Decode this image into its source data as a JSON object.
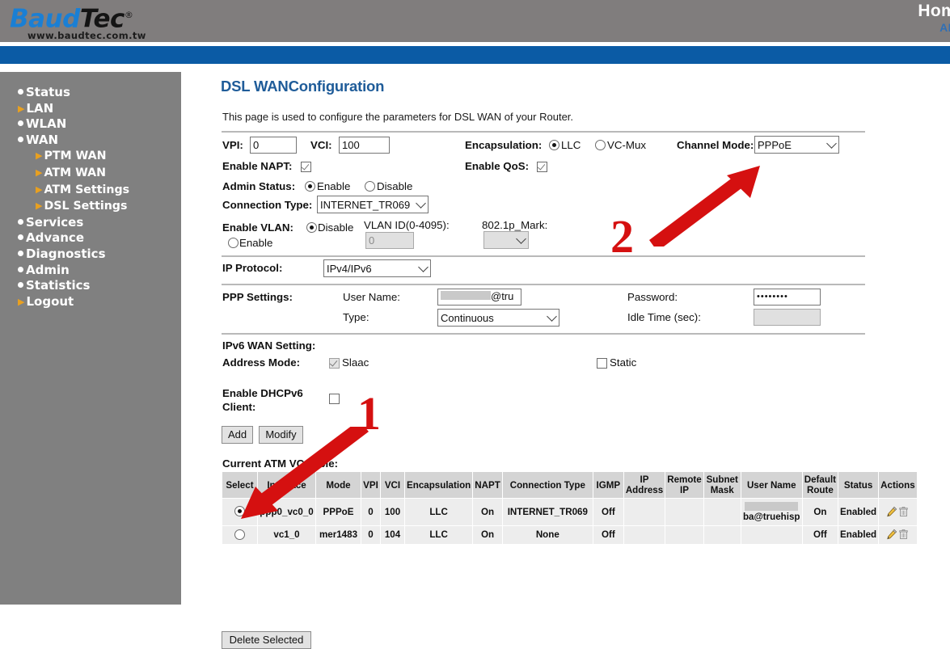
{
  "header": {
    "logo_brand_1": "Baud",
    "logo_brand_2": "Tec",
    "logo_reg": "®",
    "logo_url": "www.baudtec.com.tw",
    "home_label": "Hom",
    "adsl_label": "AD"
  },
  "sidebar": {
    "items": [
      {
        "label": "Status",
        "marker": "bullet",
        "sub": false
      },
      {
        "label": "LAN",
        "marker": "arrow",
        "sub": false
      },
      {
        "label": "WLAN",
        "marker": "bullet",
        "sub": false
      },
      {
        "label": "WAN",
        "marker": "bullet",
        "sub": false
      },
      {
        "label": "PTM WAN",
        "marker": "arrow",
        "sub": true
      },
      {
        "label": "ATM WAN",
        "marker": "arrow",
        "sub": true
      },
      {
        "label": "ATM Settings",
        "marker": "arrow",
        "sub": true
      },
      {
        "label": "DSL Settings",
        "marker": "arrow",
        "sub": true
      },
      {
        "label": "Services",
        "marker": "bullet",
        "sub": false
      },
      {
        "label": "Advance",
        "marker": "bullet",
        "sub": false
      },
      {
        "label": "Diagnostics",
        "marker": "bullet",
        "sub": false
      },
      {
        "label": "Admin",
        "marker": "bullet",
        "sub": false
      },
      {
        "label": "Statistics",
        "marker": "bullet",
        "sub": false
      },
      {
        "label": "Logout",
        "marker": "arrow",
        "sub": false
      }
    ]
  },
  "page": {
    "title": "DSL WANConfiguration",
    "description": "This page is used to configure the parameters for DSL WAN of your Router."
  },
  "form": {
    "vpi_label": "VPI:",
    "vpi_value": "0",
    "vci_label": "VCI:",
    "vci_value": "100",
    "encapsulation_label": "Encapsulation:",
    "encap_llc_label": "LLC",
    "encap_vcmux_label": "VC-Mux",
    "channel_mode_label": "Channel Mode:",
    "channel_mode_value": "PPPoE",
    "enable_napt_label": "Enable NAPT:",
    "enable_qos_label": "Enable QoS:",
    "admin_status_label": "Admin Status:",
    "admin_enable_label": "Enable",
    "admin_disable_label": "Disable",
    "connection_type_label": "Connection Type:",
    "connection_type_value": "INTERNET_TR069",
    "enable_vlan_label": "Enable VLAN:",
    "vlan_disable_label": "Disable",
    "vlan_enable_label": "Enable",
    "vlan_id_label": "VLAN ID(0-4095):",
    "vlan_id_value": "0",
    "mark_label": "802.1p_Mark:",
    "mark_value": "",
    "ip_protocol_label": "IP Protocol:",
    "ip_protocol_value": "IPv4/IPv6",
    "ppp_settings_label": "PPP Settings:",
    "user_name_label": "User Name:",
    "user_name_value": "@tru",
    "password_label": "Password:",
    "password_value": "••••••••",
    "type_label": "Type:",
    "type_value": "Continuous",
    "idle_time_label": "Idle Time (sec):",
    "idle_time_value": "",
    "ipv6_section_label": "IPv6 WAN Setting:",
    "address_mode_label": "Address Mode:",
    "slaac_label": "Slaac",
    "static_label": "Static",
    "dhcpv6_label_line1": "Enable DHCPv6",
    "dhcpv6_label_line2": "Client:",
    "add_button": "Add",
    "modify_button": "Modify"
  },
  "table": {
    "caption": "Current ATM VC Table:",
    "headers": [
      "Select",
      "Interface",
      "Mode",
      "VPI",
      "VCI",
      "Encapsulation",
      "NAPT",
      "Connection Type",
      "IGMP",
      "IP Address",
      "Remote IP",
      "Subnet Mask",
      "User Name",
      "Default Route",
      "Status",
      "Actions"
    ],
    "rows": [
      {
        "selected": true,
        "interface": "ppp0_vc0_0",
        "mode": "PPPoE",
        "vpi": "0",
        "vci": "100",
        "encapsulation": "LLC",
        "napt": "On",
        "connection_type": "INTERNET_TR069",
        "igmp": "Off",
        "ip_address": "",
        "remote_ip": "",
        "subnet_mask": "",
        "user_name": "ba@truehisp",
        "user_name_redacted": true,
        "default_route": "On",
        "status": "Enabled"
      },
      {
        "selected": false,
        "interface": "vc1_0",
        "mode": "mer1483",
        "vpi": "0",
        "vci": "104",
        "encapsulation": "LLC",
        "napt": "On",
        "connection_type": "None",
        "igmp": "Off",
        "ip_address": "",
        "remote_ip": "",
        "subnet_mask": "",
        "user_name": "",
        "user_name_redacted": false,
        "default_route": "Off",
        "status": "Enabled"
      }
    ],
    "delete_button": "Delete Selected"
  },
  "annotations": [
    {
      "number": "1"
    },
    {
      "number": "2"
    }
  ],
  "colors": {
    "header_gray": "#807d7d",
    "blue_bar": "#0b5ba5",
    "sidebar_gray": "#808080",
    "title_blue": "#1f5c99",
    "annotation_red": "#d51010",
    "nav_arrow_orange": "#e8a020"
  }
}
